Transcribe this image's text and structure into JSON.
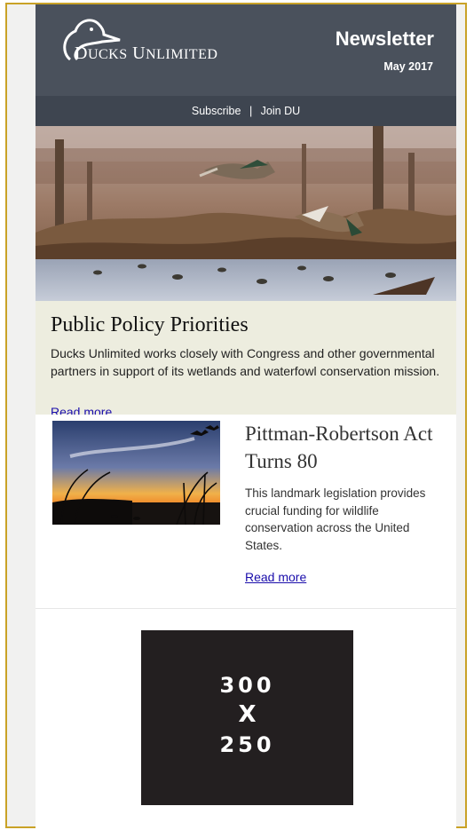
{
  "header": {
    "brand_first": "D",
    "brand_rest": "UCKS",
    "brand_second_first": "U",
    "brand_second_rest": "NLIMITED",
    "newsletter_title": "Newsletter",
    "issue_date": "May 2017"
  },
  "subscribe_bar": {
    "subscribe_label": "Subscribe",
    "separator": "|",
    "join_label": "Join DU"
  },
  "hero": {
    "image_description_icon": "mallard-ducks-flying-over-flooded-timber-photo"
  },
  "policy": {
    "title": "Public Policy Priorities",
    "body": "Ducks Unlimited works closely with Congress and other governmental partners in support of its wetlands and waterfowl conservation mission.",
    "read_more": "Read more"
  },
  "article": {
    "image_icon": "sunset-marsh-with-geese-photo",
    "title": "Pittman-Robertson Act Turns 80",
    "body": "This landmark legislation provides crucial funding for wildlife conservation across the United States.",
    "read_more": "Read more"
  },
  "ad": {
    "line1": "300",
    "line2": "X",
    "line3": "250"
  },
  "colors": {
    "header_bg": "#4a515c",
    "subbar_bg": "#3e4550",
    "policy_bg": "#ededdf",
    "frame_border": "#c9a227",
    "link": "#1a0dab",
    "ad_bg": "#231f20"
  }
}
